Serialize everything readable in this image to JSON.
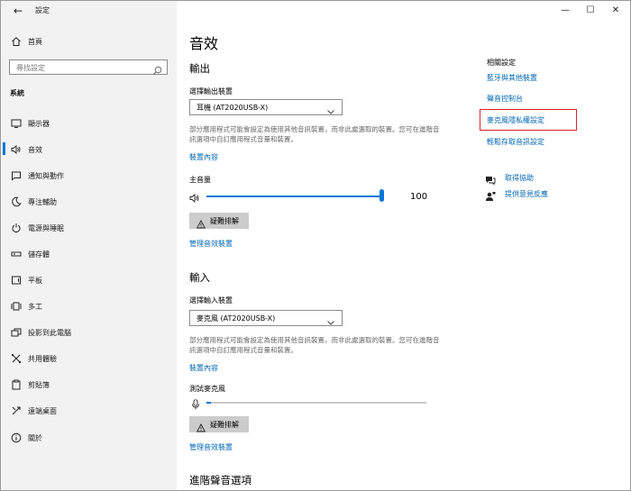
{
  "window": {
    "app_title": "設定",
    "controls": {
      "minimize": "—",
      "maximize": "☐",
      "close": "✕"
    }
  },
  "sidebar": {
    "home_label": "首頁",
    "search_placeholder": "尋找設定",
    "section_label": "系統",
    "items": [
      {
        "label": "顯示器",
        "icon": "display-icon"
      },
      {
        "label": "音效",
        "icon": "speaker-icon",
        "selected": true
      },
      {
        "label": "通知與動作",
        "icon": "notification-icon"
      },
      {
        "label": "專注輔助",
        "icon": "moon-icon"
      },
      {
        "label": "電源與睡眠",
        "icon": "power-icon"
      },
      {
        "label": "儲存體",
        "icon": "storage-icon"
      },
      {
        "label": "平板",
        "icon": "tablet-icon"
      },
      {
        "label": "多工",
        "icon": "multitasking-icon"
      },
      {
        "label": "投影到此電腦",
        "icon": "project-icon"
      },
      {
        "label": "共用體驗",
        "icon": "shared-experiences-icon"
      },
      {
        "label": "剪貼簿",
        "icon": "clipboard-icon"
      },
      {
        "label": "遠端桌面",
        "icon": "remote-desktop-icon"
      },
      {
        "label": "關於",
        "icon": "info-icon"
      }
    ]
  },
  "main": {
    "page_title": "音效",
    "output": {
      "heading": "輸出",
      "device_label": "選擇輸出裝置",
      "device_value": "耳機 (AT2020USB-X)",
      "description": "部分應用程式可能會設定為使用其他音訊裝置，而非此處選取的裝置。您可在進階音訊選項中自訂應用程式音量和裝置。",
      "device_properties_link": "裝置內容",
      "volume_label": "主音量",
      "volume_value": "100",
      "volume_level_percent": 100,
      "troubleshoot_label": "疑難排解",
      "manage_devices_link": "管理音效裝置"
    },
    "input": {
      "heading": "輸入",
      "device_label": "選擇輸入裝置",
      "device_value": "麥克風 (AT2020USB-X)",
      "description": "部分應用程式可能會設定為使用其他音訊裝置，而非此處選取的裝置。您可在進階音訊選項中自訂應用程式音量和裝置。",
      "device_properties_link": "裝置內容",
      "test_mic_label": "測試麥克風",
      "mic_level_percent": 2,
      "troubleshoot_label": "疑難排解",
      "manage_devices_link": "管理音效裝置"
    },
    "advanced_heading": "進階聲音選項"
  },
  "related": {
    "title": "相關設定",
    "links": [
      "藍牙與其他裝置",
      "聲音控制台",
      "麥克風隱私權設定",
      "輕鬆存取音訊設定"
    ],
    "highlighted_link_index": 2,
    "help_label": "取得協助",
    "feedback_label": "提供意見反應"
  },
  "colors": {
    "accent": "#0078d7",
    "link": "#0066b4",
    "highlight_border": "#e0202a",
    "sidebar_bg": "#f2f2f2"
  }
}
